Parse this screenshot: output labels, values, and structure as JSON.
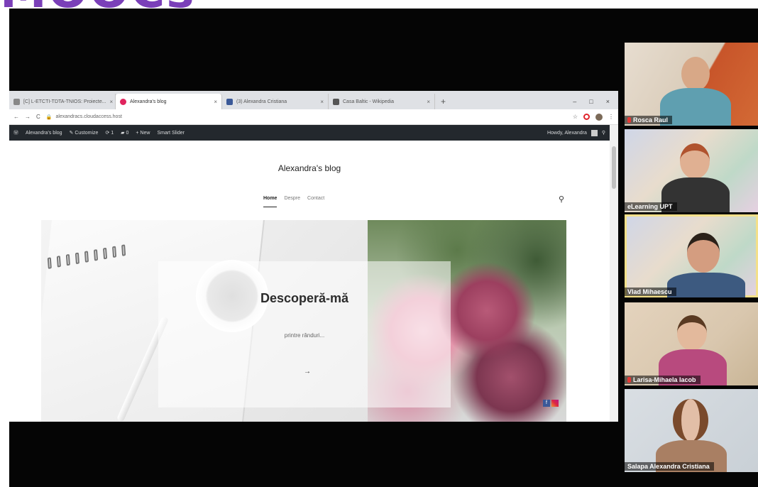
{
  "banner": {
    "text": "MOOCs"
  },
  "browser": {
    "tabs": [
      {
        "label": "[C] L-ETCTI-TDTA-TNIOS: Proiecte...",
        "favicon_color": "#888888",
        "active": false
      },
      {
        "label": "Alexandra's blog",
        "favicon_color": "#e0245e",
        "active": true
      },
      {
        "label": "(3) Alexandra Cristiana",
        "favicon_color": "#3b5998",
        "active": false
      },
      {
        "label": "Casa Baltic - Wikipedia",
        "favicon_color": "#555555",
        "active": false
      }
    ],
    "new_tab": "+",
    "window_controls": [
      "–",
      "□",
      "×"
    ],
    "address": {
      "back": "←",
      "forward": "→",
      "reload": "C",
      "url": "alexandracs.cloudaccess.host",
      "bookmark_icon": "☆"
    },
    "wp_admin_bar": {
      "items": [
        "Alexandra's blog",
        "Customize",
        "1",
        "0",
        "+ New",
        "Smart Slider"
      ],
      "greeting": "Howdy, Alexandra"
    }
  },
  "site": {
    "title": "Alexandra's blog",
    "nav": [
      "Home",
      "Despre",
      "Contact"
    ],
    "hero": {
      "title": "Descoperă-mă",
      "subtitle": "printre rânduri...",
      "arrow": "→"
    }
  },
  "participants": [
    {
      "name": "Rosca Raul",
      "muted": true,
      "highlighted": false
    },
    {
      "name": "eLearning UPT",
      "muted": false,
      "highlighted": false
    },
    {
      "name": "Vlad Mihaescu",
      "muted": false,
      "highlighted": true
    },
    {
      "name": "Larisa-Mihaela Iacob",
      "muted": true,
      "highlighted": false
    },
    {
      "name": "Salapa Alexandra Cristiana",
      "muted": false,
      "highlighted": false
    }
  ]
}
